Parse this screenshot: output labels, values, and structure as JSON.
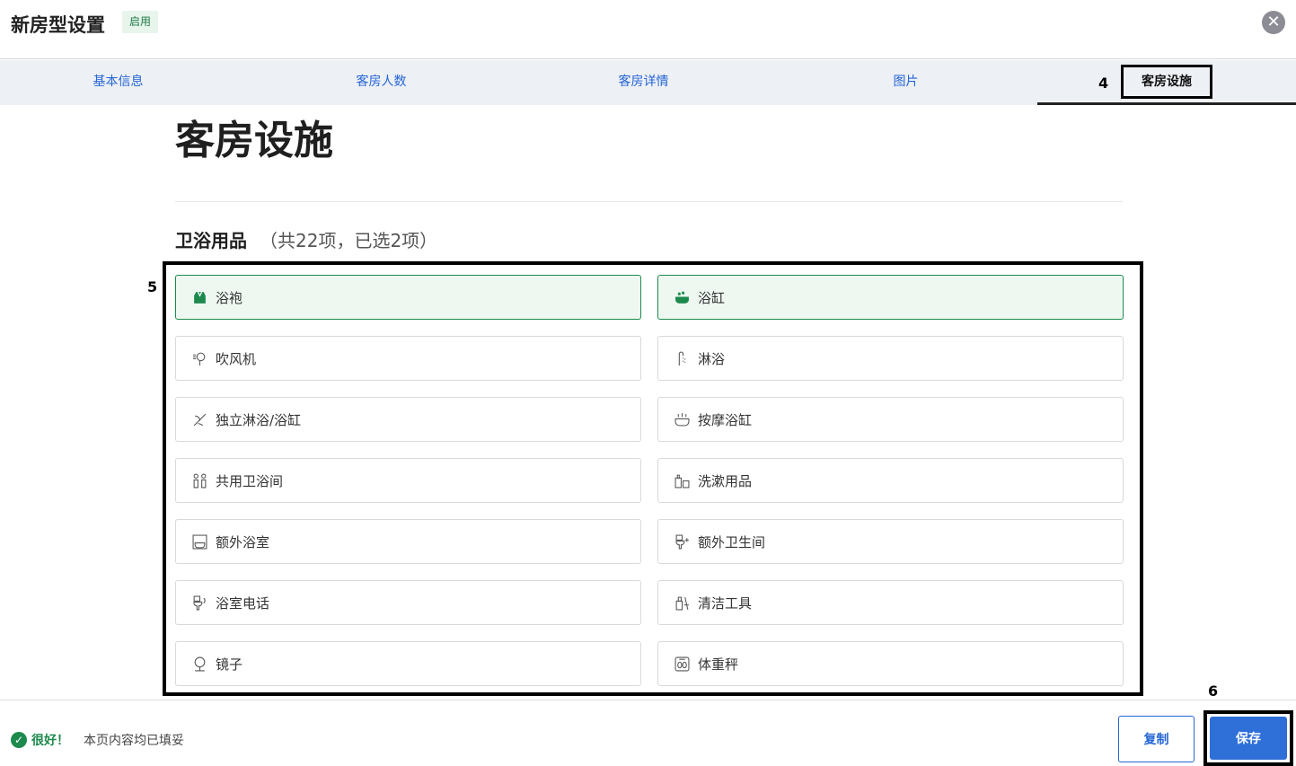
{
  "header": {
    "title": "新房型设置",
    "badge": "启用",
    "close_icon": "close-icon"
  },
  "tabs": [
    {
      "label": "基本信息"
    },
    {
      "label": "客房人数"
    },
    {
      "label": "客房详情"
    },
    {
      "label": "图片"
    },
    {
      "label": "客房设施",
      "active": true
    }
  ],
  "annotations": {
    "a4": "4",
    "a5": "5",
    "a6": "6"
  },
  "page": {
    "heading": "客房设施"
  },
  "section": {
    "name": "卫浴用品",
    "count": "（共22项，已选2项）"
  },
  "amenities": [
    {
      "label": "浴袍",
      "icon": "bathrobe-icon",
      "selected": true
    },
    {
      "label": "浴缸",
      "icon": "bathtub-icon",
      "selected": true
    },
    {
      "label": "吹风机",
      "icon": "hair-dryer-icon",
      "selected": false
    },
    {
      "label": "淋浴",
      "icon": "shower-icon",
      "selected": false
    },
    {
      "label": "独立淋浴/浴缸",
      "icon": "separate-shower-icon",
      "selected": false
    },
    {
      "label": "按摩浴缸",
      "icon": "jacuzzi-icon",
      "selected": false
    },
    {
      "label": "共用卫浴间",
      "icon": "shared-bathroom-icon",
      "selected": false
    },
    {
      "label": "洗漱用品",
      "icon": "toiletries-icon",
      "selected": false
    },
    {
      "label": "额外浴室",
      "icon": "extra-bathroom-icon",
      "selected": false
    },
    {
      "label": "额外卫生间",
      "icon": "extra-toilet-icon",
      "selected": false
    },
    {
      "label": "浴室电话",
      "icon": "bathroom-phone-icon",
      "selected": false
    },
    {
      "label": "清洁工具",
      "icon": "cleaning-tools-icon",
      "selected": false
    },
    {
      "label": "镜子",
      "icon": "mirror-icon",
      "selected": false
    },
    {
      "label": "体重秤",
      "icon": "scale-icon",
      "selected": false
    }
  ],
  "footer": {
    "status_label": "很好！",
    "status_message": "本页内容均已填妥",
    "copy_label": "复制",
    "save_label": "保存"
  }
}
